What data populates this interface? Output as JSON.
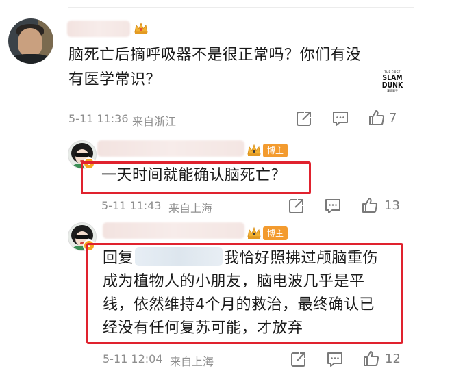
{
  "post": {
    "text_line1": "脑死亡后摘呼吸器不是很正常吗？你们有没",
    "text_line2": "有医学常识？",
    "timestamp": "5-11 11:36",
    "source": "来自浙江",
    "like_count": "7",
    "badge": {
      "small": "THE FIRST",
      "line1": "SLAM",
      "line2": "DUNK",
      "tiny": "灌篮高手"
    }
  },
  "reply1": {
    "author_badge": "博主",
    "text": "一天时间就能确认脑死亡？",
    "timestamp": "5-11 11:43",
    "source": "来自上海",
    "like_count": "13"
  },
  "reply2": {
    "author_badge": "博主",
    "prefix": "回复",
    "line1_rest": "我恰好照拂过颅脑重伤",
    "line2": "成为植物人的小朋友，脑电波几乎是平",
    "line3": "线，依然维持4个月的救治，最终确认已",
    "line4": "经没有任何复苏可能，才放弃",
    "timestamp": "5-11 12:04",
    "source": "来自上海",
    "like_count": "12"
  },
  "colors": {
    "highlight_border": "#e0222e",
    "badge_orange": "#f39b2f",
    "meta_gray": "#8f8f8f"
  },
  "icons": [
    "share-icon",
    "comment-icon",
    "like-icon",
    "crown-icon",
    "verified-icon"
  ]
}
